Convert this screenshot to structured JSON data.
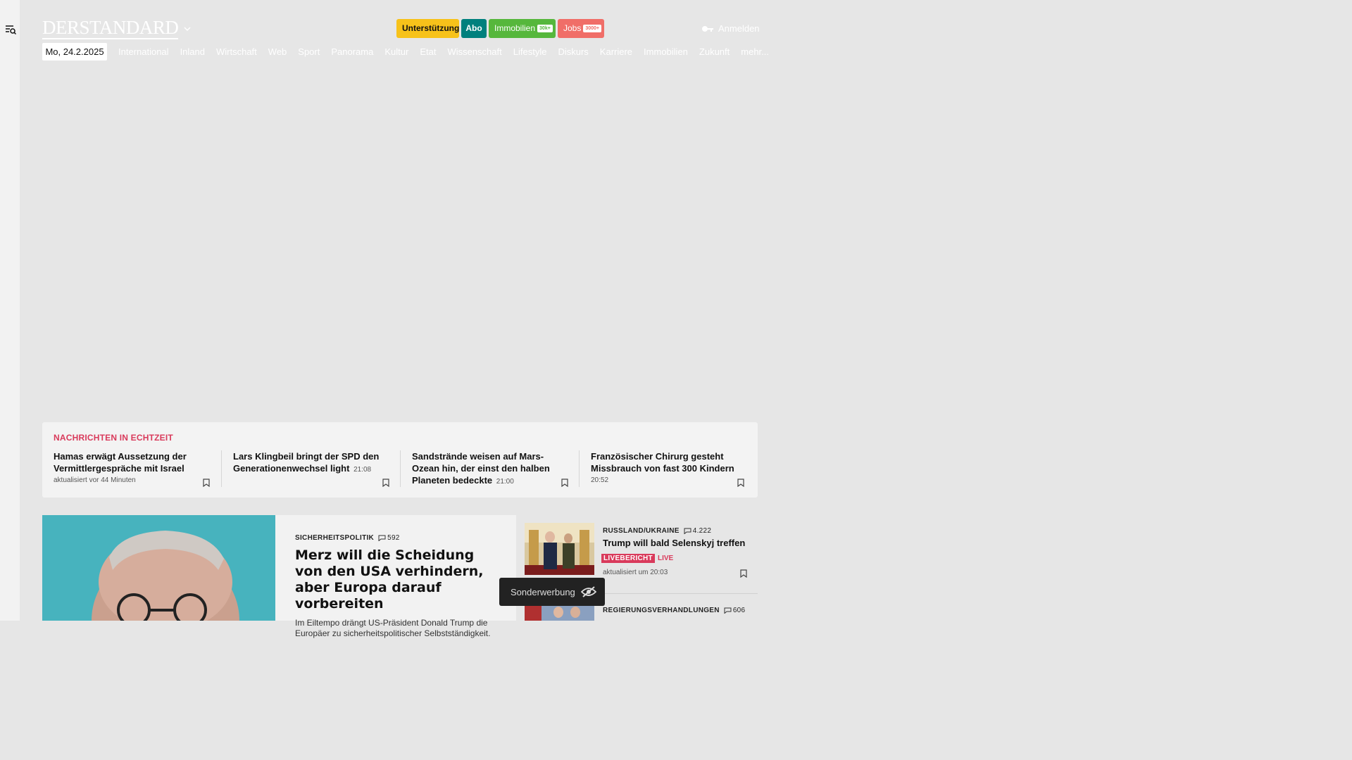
{
  "header": {
    "logo_text": "DERSTANDARD",
    "support_label": "Unterstützung",
    "abo_label": "Abo",
    "immobilien_label": "Immobilien",
    "immobilien_tag": "30k+",
    "jobs_label": "Jobs",
    "jobs_tag": "3000+",
    "login_label": "Anmelden"
  },
  "date": "Mo, 24.2.2025",
  "nav": [
    "International",
    "Inland",
    "Wirtschaft",
    "Web",
    "Sport",
    "Panorama",
    "Kultur",
    "Etat",
    "Wissenschaft",
    "Lifestyle",
    "Diskurs",
    "Karriere",
    "Immobilien",
    "Zukunft",
    "mehr..."
  ],
  "ticker": {
    "title": "NACHRICHTEN IN ECHTZEIT",
    "items": [
      {
        "headline": "Hamas erwägt Aussetzung der Vermittlergespräche mit Israel",
        "time": "",
        "sub": "aktualisiert vor 44 Minuten"
      },
      {
        "headline": "Lars Klingbeil bringt der SPD den Generationenwechsel light",
        "time": "21:08",
        "sub": ""
      },
      {
        "headline": "Sandstrände weisen auf Mars-Ozean hin, der einst den halben Planeten bedeckte",
        "time": "21:00",
        "sub": ""
      },
      {
        "headline": "Französischer Chirurg gesteht Missbrauch von fast 300 Kindern",
        "time": "",
        "sub": "20:52"
      }
    ]
  },
  "hero": {
    "kicker": "SICHERHEITSPOLITIK",
    "comments": "592",
    "headline": "Merz will die Scheidung von den USA verhindern, aber Europa darauf vorbereiten",
    "teaser": "Im Eiltempo drängt US-Präsident Donald Trump die Europäer zu sicherheitspolitischer Selbstständigkeit."
  },
  "side": [
    {
      "kicker": "RUSSLAND/UKRAINE",
      "comments": "4.222",
      "headline": "Trump will bald Selenskyj treffen",
      "badge": "LIVEBERICHT",
      "badge_text": "LIVE",
      "sub": "aktualisiert um 20:03"
    },
    {
      "kicker": "REGIERUNGSVERHANDLUNGEN",
      "comments": "606"
    }
  ],
  "promo_label": "Sonderwerbung",
  "colors": {
    "accent_red": "#d93a5b",
    "support": "#f7c21a",
    "abo": "#00807d",
    "immobilien": "#56b73c",
    "jobs": "#f06e68"
  }
}
